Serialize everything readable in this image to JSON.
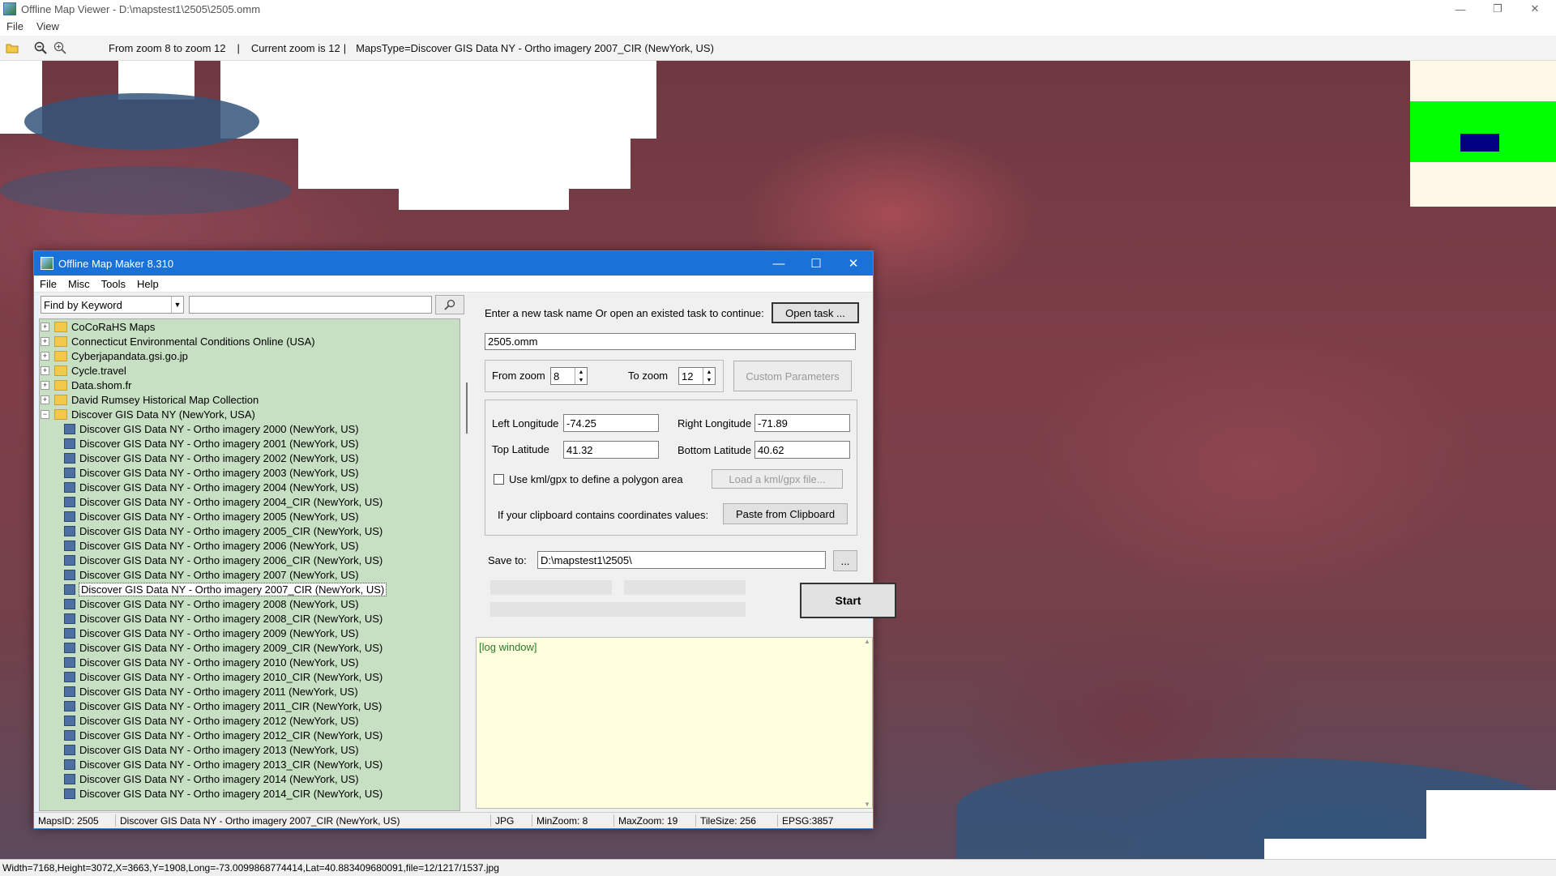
{
  "window": {
    "title": "Offline Map Viewer - D:\\mapstest1\\2505\\2505.omm",
    "controls": {
      "minimize": "—",
      "restore": "❐",
      "close": "✕"
    }
  },
  "menu": [
    "File",
    "View"
  ],
  "toolbar": {
    "zoom_range": "From zoom 8 to zoom 12",
    "current_zoom": "Current zoom is 12",
    "separator": "|",
    "maps_type": "MapsType=Discover GIS Data NY - Ortho imagery 2007_CIR (NewYork, US)"
  },
  "status": "Width=7168,Height=3072,X=3663,Y=1908,Long=-73.0099868774414,Lat=40.883409680091,file=12/1217/1537.jpg",
  "dialog": {
    "title": "Offline Map Maker 8.310",
    "menu": [
      "File",
      "Misc",
      "Tools",
      "Help"
    ],
    "find_mode": "Find by Keyword",
    "tree": [
      {
        "label": "CoCoRaHS Maps",
        "level": 0,
        "exp": "+"
      },
      {
        "label": "Connecticut Environmental Conditions Online (USA)",
        "level": 0,
        "exp": "+"
      },
      {
        "label": "Cyberjapandata.gsi.go.jp",
        "level": 0,
        "exp": "+"
      },
      {
        "label": "Cycle.travel",
        "level": 0,
        "exp": "+"
      },
      {
        "label": "Data.shom.fr",
        "level": 0,
        "exp": "+"
      },
      {
        "label": "David Rumsey Historical Map Collection",
        "level": 0,
        "exp": "+"
      },
      {
        "label": "Discover GIS Data NY (NewYork, USA)",
        "level": 0,
        "exp": "−"
      },
      {
        "label": "Discover GIS Data NY - Ortho imagery 2000 (NewYork, US)",
        "level": 1
      },
      {
        "label": "Discover GIS Data NY - Ortho imagery 2001 (NewYork, US)",
        "level": 1
      },
      {
        "label": "Discover GIS Data NY - Ortho imagery 2002 (NewYork, US)",
        "level": 1
      },
      {
        "label": "Discover GIS Data NY - Ortho imagery 2003 (NewYork, US)",
        "level": 1
      },
      {
        "label": "Discover GIS Data NY - Ortho imagery 2004 (NewYork, US)",
        "level": 1
      },
      {
        "label": "Discover GIS Data NY - Ortho imagery 2004_CIR (NewYork, US)",
        "level": 1
      },
      {
        "label": "Discover GIS Data NY - Ortho imagery 2005 (NewYork, US)",
        "level": 1
      },
      {
        "label": "Discover GIS Data NY - Ortho imagery 2005_CIR (NewYork, US)",
        "level": 1
      },
      {
        "label": "Discover GIS Data NY - Ortho imagery 2006 (NewYork, US)",
        "level": 1
      },
      {
        "label": "Discover GIS Data NY - Ortho imagery 2006_CIR (NewYork, US)",
        "level": 1
      },
      {
        "label": "Discover GIS Data NY - Ortho imagery 2007 (NewYork, US)",
        "level": 1
      },
      {
        "label": "Discover GIS Data NY - Ortho imagery 2007_CIR (NewYork, US)",
        "level": 1,
        "selected": true
      },
      {
        "label": "Discover GIS Data NY - Ortho imagery 2008 (NewYork, US)",
        "level": 1
      },
      {
        "label": "Discover GIS Data NY - Ortho imagery 2008_CIR (NewYork, US)",
        "level": 1
      },
      {
        "label": "Discover GIS Data NY - Ortho imagery 2009 (NewYork, US)",
        "level": 1
      },
      {
        "label": "Discover GIS Data NY - Ortho imagery 2009_CIR (NewYork, US)",
        "level": 1
      },
      {
        "label": "Discover GIS Data NY - Ortho imagery 2010 (NewYork, US)",
        "level": 1
      },
      {
        "label": "Discover GIS Data NY - Ortho imagery 2010_CIR (NewYork, US)",
        "level": 1
      },
      {
        "label": "Discover GIS Data NY - Ortho imagery 2011 (NewYork, US)",
        "level": 1
      },
      {
        "label": "Discover GIS Data NY - Ortho imagery 2011_CIR (NewYork, US)",
        "level": 1
      },
      {
        "label": "Discover GIS Data NY - Ortho imagery 2012 (NewYork, US)",
        "level": 1
      },
      {
        "label": "Discover GIS Data NY - Ortho imagery 2012_CIR (NewYork, US)",
        "level": 1
      },
      {
        "label": "Discover GIS Data NY - Ortho imagery 2013 (NewYork, US)",
        "level": 1
      },
      {
        "label": "Discover GIS Data NY - Ortho imagery 2013_CIR (NewYork, US)",
        "level": 1
      },
      {
        "label": "Discover GIS Data NY - Ortho imagery 2014 (NewYork, US)",
        "level": 1
      },
      {
        "label": "Discover GIS Data NY - Ortho imagery 2014_CIR (NewYork, US)",
        "level": 1
      }
    ],
    "task_prompt": "Enter a new task name Or open an existed task to continue:",
    "open_task": "Open task ...",
    "task_name": "2505.omm",
    "from_zoom_label": "From zoom",
    "from_zoom": "8",
    "to_zoom_label": "To zoom",
    "to_zoom": "12",
    "custom_params": "Custom Parameters",
    "left_lon_label": "Left Longitude",
    "left_lon": "-74.25",
    "right_lon_label": "Right Longitude",
    "right_lon": "-71.89",
    "top_lat_label": "Top Latitude",
    "top_lat": "41.32",
    "bottom_lat_label": "Bottom Latitude",
    "bottom_lat": "40.62",
    "kml_label": "Use kml/gpx to define a polygon area",
    "load_kml": "Load a kml/gpx file...",
    "clipboard_label": "If your clipboard contains coordinates values:",
    "paste": "Paste from Clipboard",
    "save_label": "Save to:",
    "save_path": "D:\\mapstest1\\2505\\",
    "browse": "...",
    "start": "Start",
    "log": "[log window]",
    "status": {
      "maps_id": "MapsID: 2505",
      "maps_name": "Discover GIS Data NY - Ortho imagery 2007_CIR (NewYork, US)",
      "format": "JPG",
      "min_zoom": "MinZoom: 8",
      "max_zoom": "MaxZoom: 19",
      "tile_size": "TileSize: 256",
      "epsg": "EPSG:3857"
    }
  },
  "colors": {
    "dialog_title": "#1a72d9",
    "tree_bg": "#c7e0c3",
    "log_bg": "#ffffe0",
    "overview_green": "#00ff00",
    "overview_blue": "#000080"
  }
}
